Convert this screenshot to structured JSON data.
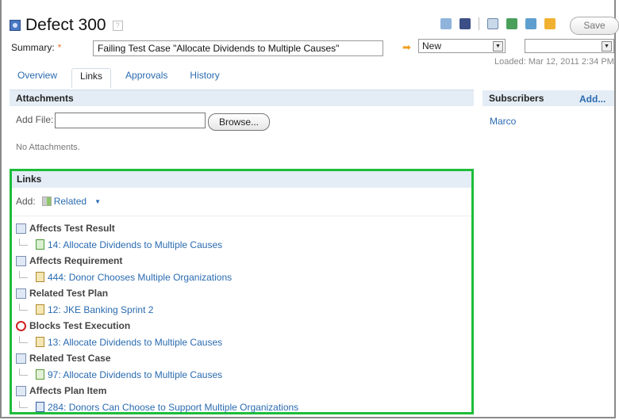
{
  "header": {
    "title": "Defect 300",
    "title_icon": "defect-icon",
    "help_icon": "help-icon"
  },
  "summary": {
    "label": "Summary:",
    "required_marker": "*",
    "value": "Failing Test Case \"Allocate Dividends to Multiple Causes\""
  },
  "toolbar": {
    "icons": [
      "print-icon",
      "snapshot-icon",
      "find-related-icon",
      "add-subscriber-icon",
      "refresh-workitem-icon",
      "duplicate-icon"
    ],
    "save_label": "Save"
  },
  "workflow": {
    "action_icon": "arrow-right-icon",
    "state_value": "New",
    "resolution_value": ""
  },
  "loaded_text": "Loaded: Mar 12, 2011 2:34 PM",
  "tabs": [
    {
      "label": "Overview",
      "active": false
    },
    {
      "label": "Links",
      "active": true
    },
    {
      "label": "Approvals",
      "active": false
    },
    {
      "label": "History",
      "active": false
    }
  ],
  "attachments": {
    "title": "Attachments",
    "add_file_label": "Add File:",
    "browse_label": "Browse...",
    "empty_text": "No Attachments."
  },
  "subscribers": {
    "title": "Subscribers",
    "add_label": "Add...",
    "items": [
      "Marco"
    ]
  },
  "links": {
    "title": "Links",
    "add_label": "Add:",
    "add_type": "Related",
    "groups": [
      {
        "title": "Affects Test Result",
        "item": "14: Allocate Dividends to Multiple Causes"
      },
      {
        "title": "Affects Requirement",
        "item": "444: Donor Chooses Multiple Organizations"
      },
      {
        "title": "Related Test Plan",
        "item": "12: JKE Banking Sprint 2"
      },
      {
        "title": "Blocks Test Execution",
        "item": "13: Allocate Dividends to Multiple Causes"
      },
      {
        "title": "Related Test Case",
        "item": "97: Allocate Dividends to Multiple Causes"
      },
      {
        "title": "Affects Plan Item",
        "item": "284: Donors Can Choose to Support Multiple Organizations"
      }
    ]
  },
  "colors": {
    "link": "#2a6bb0",
    "section_bg": "#e4edf5",
    "highlight_border": "#1dbd3a",
    "required": "#e8702a"
  }
}
